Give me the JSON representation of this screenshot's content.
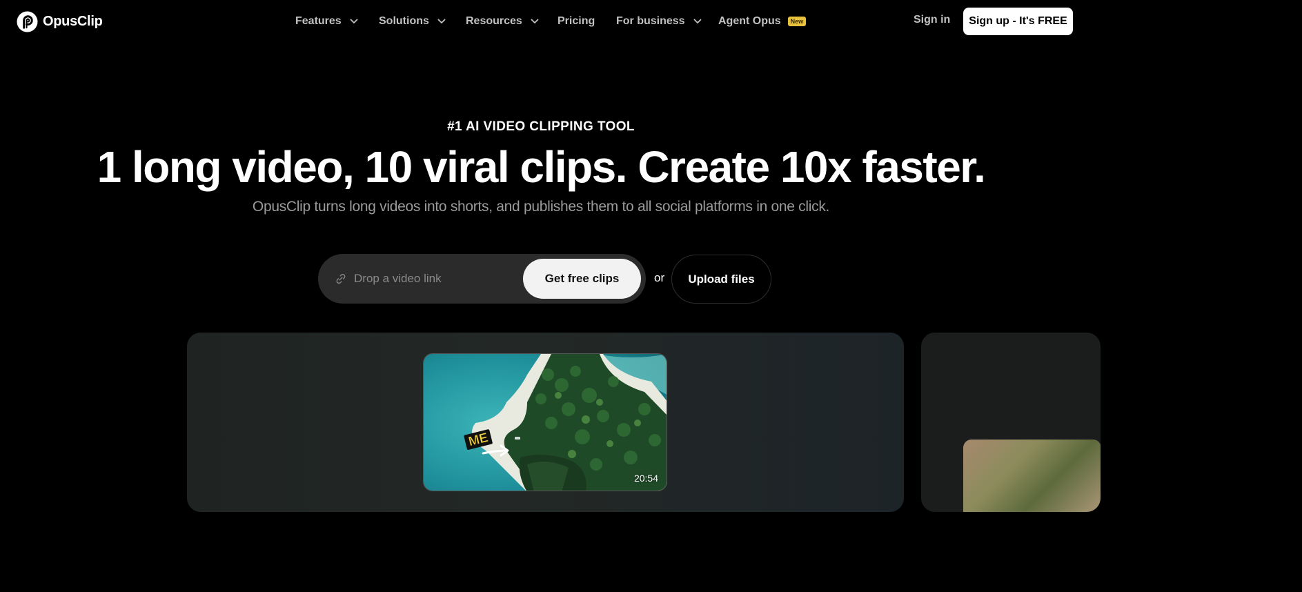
{
  "brand": {
    "name": "OpusClip"
  },
  "nav": {
    "items": [
      {
        "label": "Features",
        "has_dropdown": true
      },
      {
        "label": "Solutions",
        "has_dropdown": true
      },
      {
        "label": "Resources",
        "has_dropdown": true
      },
      {
        "label": "Pricing",
        "has_dropdown": false
      },
      {
        "label": "For business",
        "has_dropdown": true
      },
      {
        "label": "Agent Opus",
        "has_dropdown": false,
        "badge": "New"
      }
    ],
    "sign_in": "Sign in",
    "sign_up": "Sign up - It's FREE"
  },
  "hero": {
    "eyebrow": "#1 AI VIDEO CLIPPING TOOL",
    "headline": "1 long video, 10 viral clips. Create 10x faster.",
    "subheadline": "OpusClip turns long videos into shorts, and publishes them to all social platforms in one click."
  },
  "input": {
    "placeholder": "Drop a video link",
    "submit_label": "Get free clips",
    "or_label": "or",
    "upload_label": "Upload files"
  },
  "preview": {
    "video_duration": "20:54",
    "overlay_text": "ME"
  },
  "colors": {
    "background": "#000000",
    "badge": "#e8c23a",
    "nav_text": "#c2c2c2",
    "subhead_text": "#9b9b9b",
    "pill": "#2b2b2b"
  },
  "icons": {
    "logo": "opusclip-logo-icon",
    "dropdown": "chevron-down-icon",
    "link": "link-icon",
    "arrow": "arrow-right-icon"
  }
}
